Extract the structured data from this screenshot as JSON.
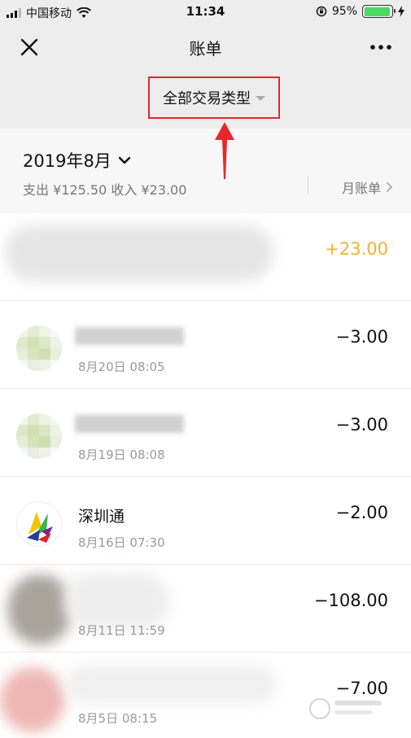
{
  "status_bar": {
    "carrier": "中国移动",
    "time": "11:34",
    "battery_percent": "95%",
    "battery_level": 0.95
  },
  "nav": {
    "title": "账单"
  },
  "filter": {
    "label": "全部交易类型"
  },
  "month": {
    "label": "2019年8月",
    "summary": "支出 ¥125.50 收入 ¥23.00",
    "monthly_bill_label": "月账单"
  },
  "transactions": [
    {
      "name": "",
      "date": "",
      "amount": "+23.00",
      "type": "income"
    },
    {
      "name": "",
      "date": "8月20日 08:05",
      "amount": "−3.00",
      "type": "expense"
    },
    {
      "name": "",
      "date": "8月19日 08:08",
      "amount": "−3.00",
      "type": "expense"
    },
    {
      "name": "深圳通",
      "date": "8月16日 07:30",
      "amount": "−2.00",
      "type": "expense"
    },
    {
      "name": "",
      "date": "8月11日 11:59",
      "amount": "−108.00",
      "type": "expense"
    },
    {
      "name": "",
      "date": "8月5日 08:15",
      "amount": "−7.00",
      "type": "expense"
    }
  ],
  "colors": {
    "income": "#f1b32c",
    "annotation": "#e0282e",
    "header_bg": "#ededed"
  },
  "icons": {
    "close": "close-icon",
    "more": "more-icon",
    "month_chevron": "chevron-down-icon",
    "bill_chevron": "chevron-right-icon"
  }
}
